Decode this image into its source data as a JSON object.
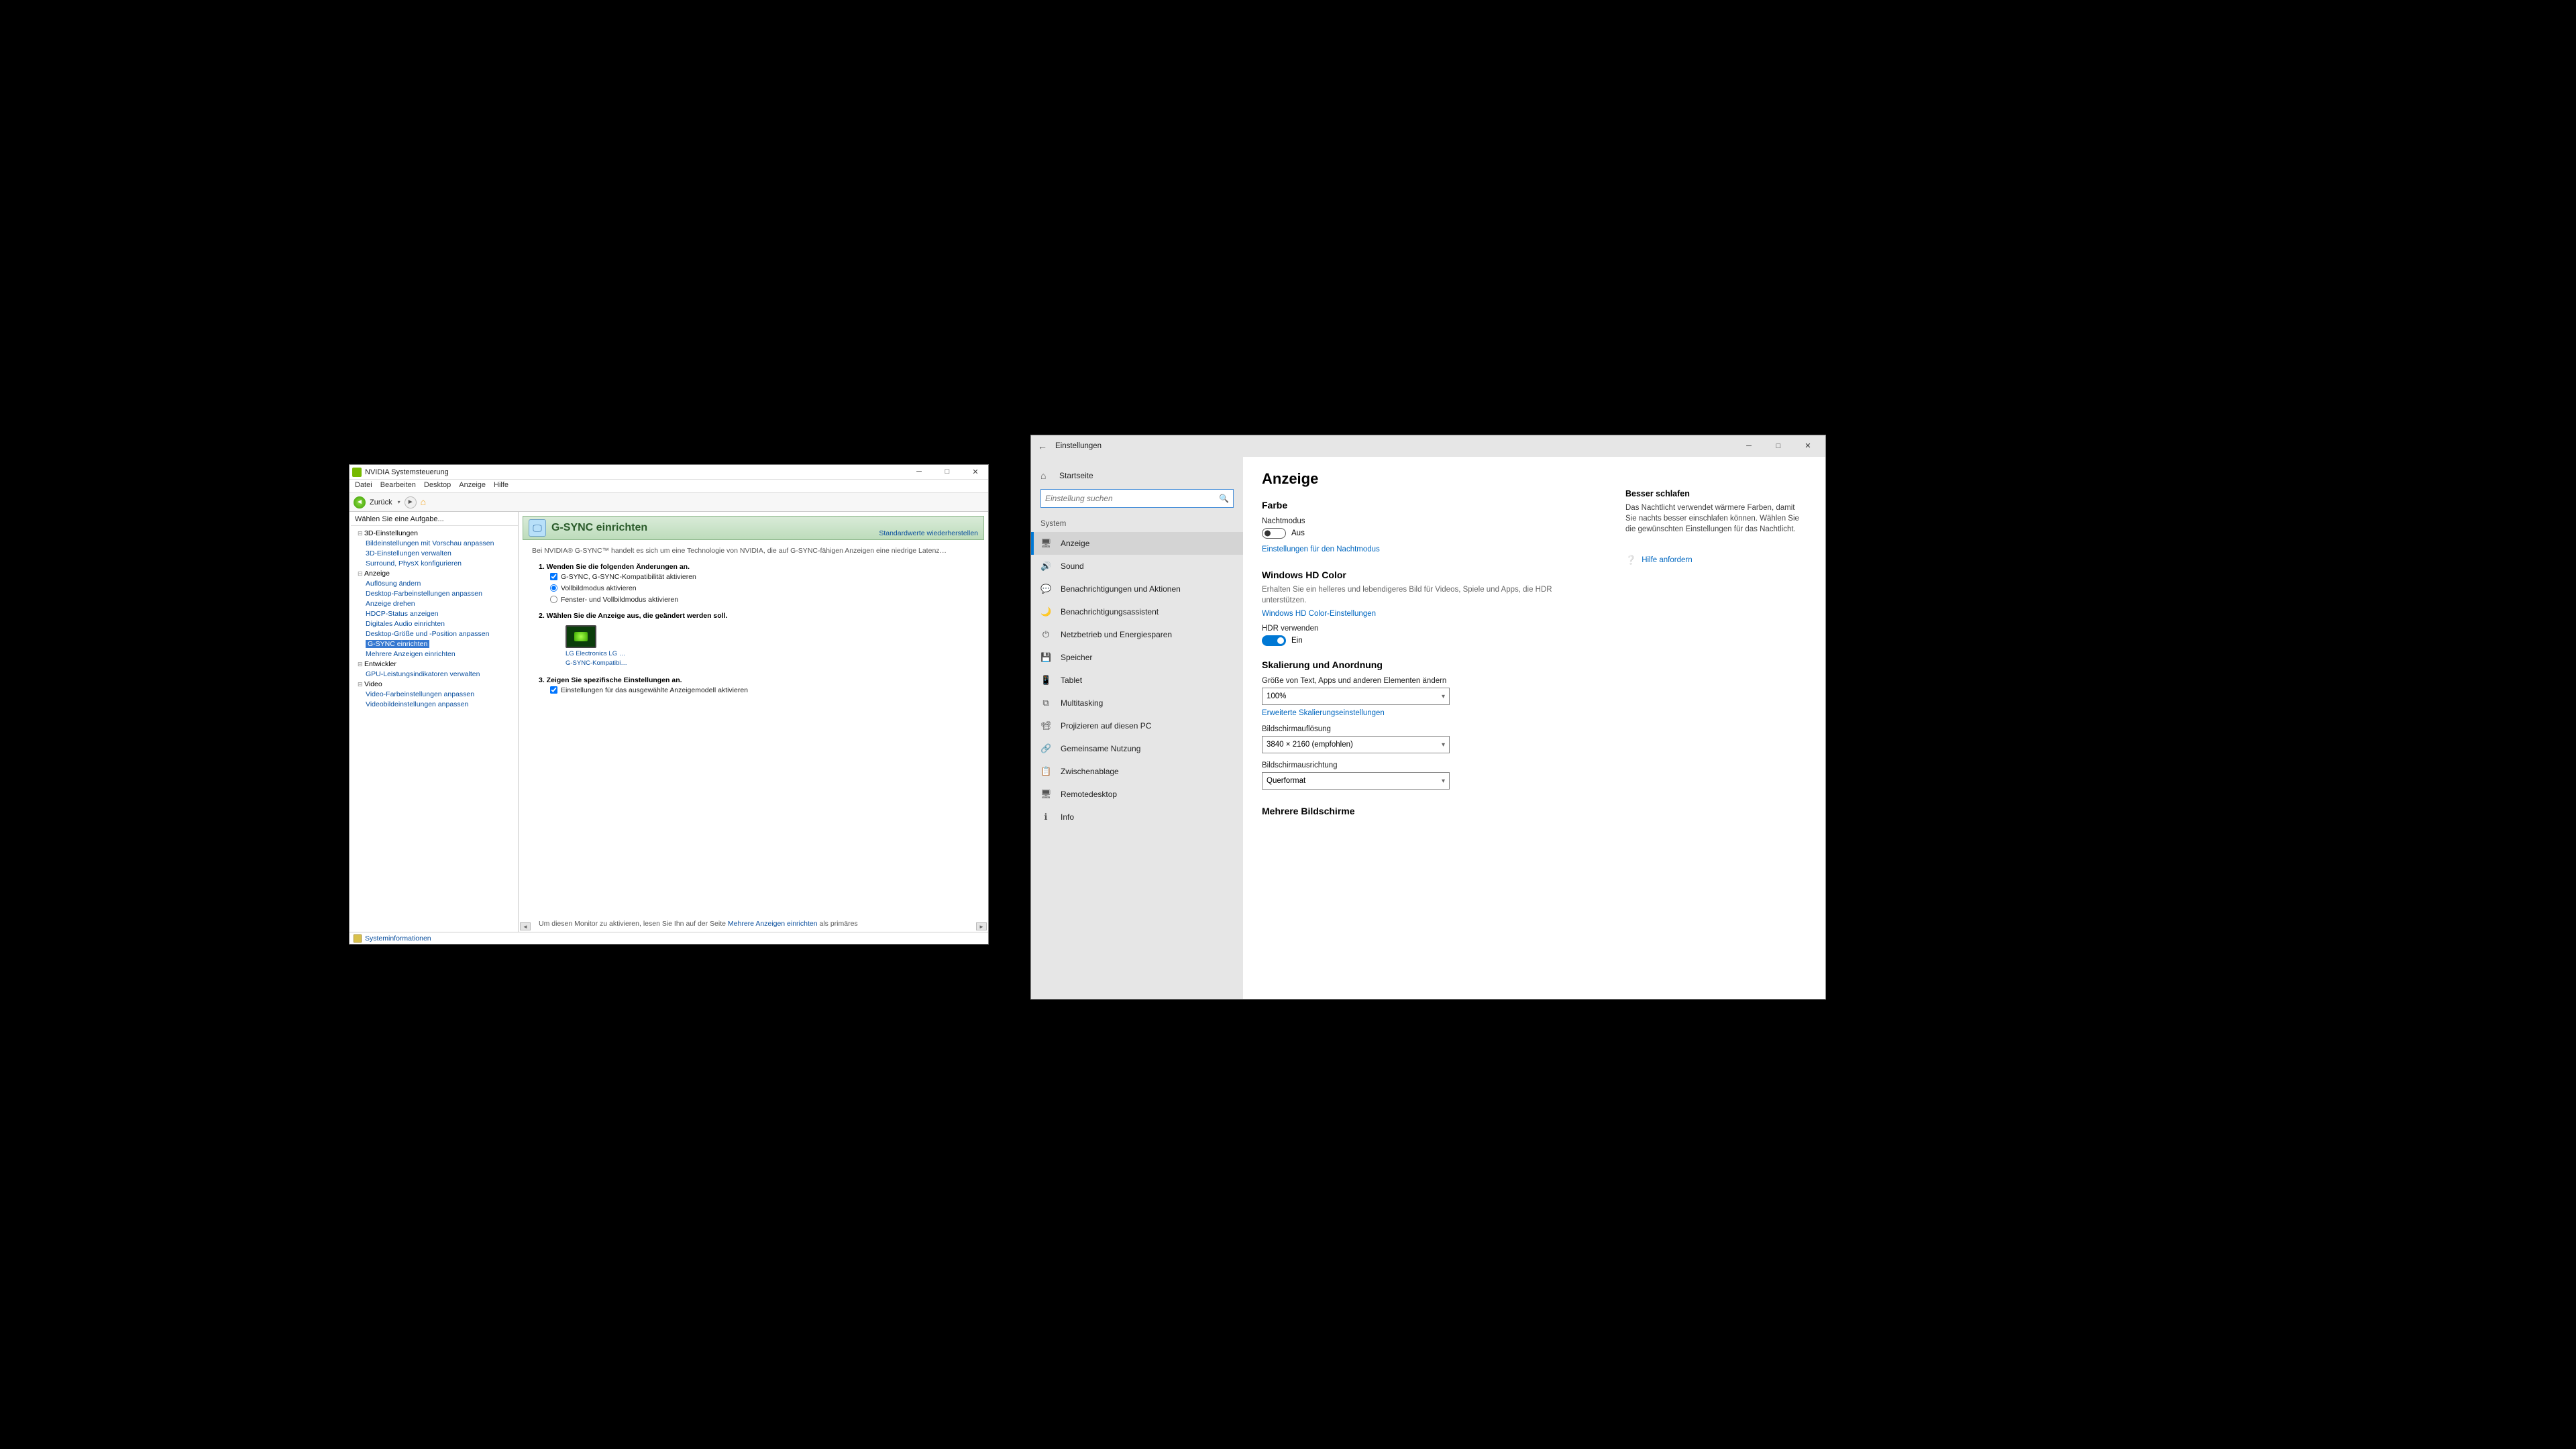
{
  "nvidia": {
    "title": "NVIDIA Systemsteuerung",
    "menu": [
      "Datei",
      "Bearbeiten",
      "Desktop",
      "Anzeige",
      "Hilfe"
    ],
    "toolbar": {
      "back": "Zurück"
    },
    "task_header": "Wählen Sie eine Aufgabe...",
    "tree": {
      "cat1": "3D-Einstellungen",
      "cat1_items": [
        "Bildeinstellungen mit Vorschau anpassen",
        "3D-Einstellungen verwalten",
        "Surround, PhysX konfigurieren"
      ],
      "cat2": "Anzeige",
      "cat2_items": [
        "Auflösung ändern",
        "Desktop-Farbeinstellungen anpassen",
        "Anzeige drehen",
        "HDCP-Status anzeigen",
        "Digitales Audio einrichten",
        "Desktop-Größe und -Position anpassen",
        "G-SYNC einrichten",
        "Mehrere Anzeigen einrichten"
      ],
      "cat3": "Entwickler",
      "cat3_items": [
        "GPU-Leistungsindikatoren verwalten"
      ],
      "cat4": "Video",
      "cat4_items": [
        "Video-Farbeinstellungen anpassen",
        "Videobildeinstellungen anpassen"
      ]
    },
    "panel": {
      "heading": "G-SYNC einrichten",
      "restore": "Standardwerte wiederherstellen",
      "intro": "Bei NVIDIA® G-SYNC™ handelt es sich um eine Technologie von NVIDIA, die auf G-SYNC-fähigen Anzeigen eine niedrige Latenz…",
      "step1": "1. Wenden Sie die folgenden Änderungen an.",
      "opt_enable": "G-SYNC, G-SYNC-Kompatibilität aktivieren",
      "opt_full": "Vollbildmodus aktivieren",
      "opt_win": "Fenster- und Vollbildmodus aktivieren",
      "step2": "2. Wählen Sie die Anzeige aus, die geändert werden soll.",
      "disp_name": "LG Electronics LG …",
      "disp_sub": "G-SYNC-Kompatibi…",
      "step3": "3. Zeigen Sie spezifische Einstellungen an.",
      "opt_model": "Einstellungen für das ausgewählte Anzeigemodell aktivieren",
      "footer_pre": "Um diesen Monitor zu aktivieren, lesen Sie Ihn auf der Seite ",
      "footer_link": "Mehrere Anzeigen einrichten",
      "footer_post": " als primäres"
    },
    "status_link": "Systeminformationen"
  },
  "settings": {
    "title": "Einstellungen",
    "home": "Startseite",
    "search_placeholder": "Einstellung suchen",
    "section": "System",
    "items": [
      {
        "icon": "🖥",
        "label": "Anzeige"
      },
      {
        "icon": "🔊",
        "label": "Sound"
      },
      {
        "icon": "💬",
        "label": "Benachrichtigungen und Aktionen"
      },
      {
        "icon": "🌙",
        "label": "Benachrichtigungsassistent"
      },
      {
        "icon": "⏻",
        "label": "Netzbetrieb und Energiesparen"
      },
      {
        "icon": "💾",
        "label": "Speicher"
      },
      {
        "icon": "📱",
        "label": "Tablet"
      },
      {
        "icon": "⧉",
        "label": "Multitasking"
      },
      {
        "icon": "📽",
        "label": "Projizieren auf diesen PC"
      },
      {
        "icon": "🔗",
        "label": "Gemeinsame Nutzung"
      },
      {
        "icon": "📋",
        "label": "Zwischenablage"
      },
      {
        "icon": "🖥",
        "label": "Remotedesktop"
      },
      {
        "icon": "ℹ",
        "label": "Info"
      }
    ],
    "page": {
      "title": "Anzeige",
      "color_head": "Farbe",
      "nightmode_label": "Nachtmodus",
      "nightmode_state": "Aus",
      "nightmode_link": "Einstellungen für den Nachtmodus",
      "hd_head": "Windows HD Color",
      "hd_desc": "Erhalten Sie ein helleres und lebendigeres Bild für Videos, Spiele und Apps, die HDR unterstützen.",
      "hd_link": "Windows HD Color-Einstellungen",
      "hdr_label": "HDR verwenden",
      "hdr_state": "Ein",
      "scale_head": "Skalierung und Anordnung",
      "scale_label": "Größe von Text, Apps und anderen Elementen ändern",
      "scale_value": "100%",
      "ext_scale_link": "Erweiterte Skalierungseinstellungen",
      "res_label": "Bildschirmauflösung",
      "res_value": "3840 × 2160 (empfohlen)",
      "orient_label": "Bildschirmausrichtung",
      "orient_value": "Querformat",
      "multi_head": "Mehrere Bildschirme"
    },
    "aside": {
      "sleep_head": "Besser schlafen",
      "sleep_desc": "Das Nachtlicht verwendet wärmere Farben, damit Sie nachts besser einschlafen können. Wählen Sie die gewünschten Einstellungen für das Nachtlicht.",
      "help": "Hilfe anfordern"
    }
  }
}
